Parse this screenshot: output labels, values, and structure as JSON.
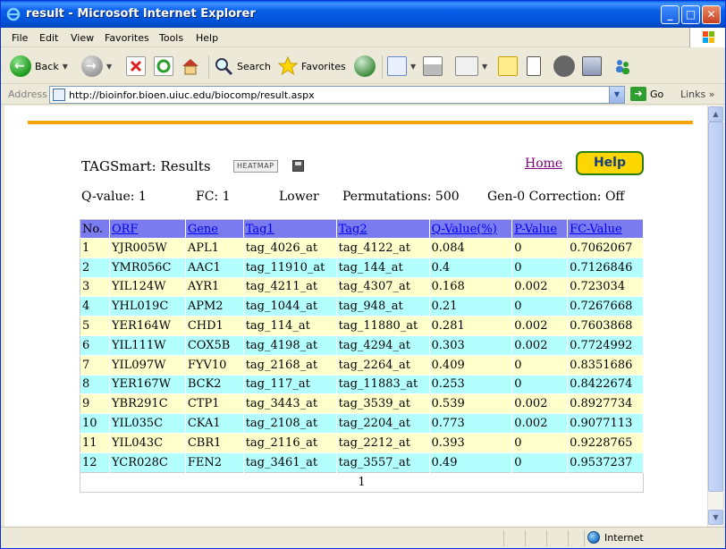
{
  "window": {
    "title": "result - Microsoft Internet Explorer",
    "controls": {
      "minimize": "_",
      "maximize": "□",
      "close": "✕"
    }
  },
  "menu": [
    "File",
    "Edit",
    "View",
    "Favorites",
    "Tools",
    "Help"
  ],
  "toolbar": {
    "back_label": "Back",
    "search_label": "Search",
    "favorites_label": "Favorites",
    "icons": [
      "back-icon",
      "forward-icon",
      "stop-icon",
      "refresh-icon",
      "home-icon",
      "search-icon",
      "favorites-icon",
      "history-icon",
      "mail-icon",
      "print-icon",
      "edit-icon",
      "discuss-icon",
      "messenger-icon",
      "research-icon",
      "media-icon",
      "people-icon"
    ]
  },
  "address": {
    "label": "Address",
    "url": "http://bioinfor.bioen.uiuc.edu/biocomp/result.aspx",
    "go_label": "Go",
    "links_label": "Links"
  },
  "page": {
    "title": "TAGSmart: Results",
    "heatmap_label": "HEATMAP",
    "home_label": "Home",
    "help_label": "Help",
    "accent_color": "#f5a400",
    "params": {
      "qvalue": "Q-value:  1",
      "fc": "FC:  1",
      "direction": "Lower",
      "permutations": "Permutations:  500",
      "gen0": "Gen-0 Correction:  Off"
    }
  },
  "table": {
    "headers": [
      "No.",
      "ORF",
      "Gene",
      "Tag1",
      "Tag2",
      "Q-Value(%)",
      "P-Value",
      "FC-Value"
    ],
    "header_links": [
      false,
      true,
      true,
      true,
      true,
      true,
      true,
      true
    ],
    "rows": [
      [
        "1",
        "YJR005W",
        "APL1",
        "tag_4026_at",
        "tag_4122_at",
        "0.084",
        "0",
        "0.7062067"
      ],
      [
        "2",
        "YMR056C",
        "AAC1",
        "tag_11910_at",
        "tag_144_at",
        "0.4",
        "0",
        "0.7126846"
      ],
      [
        "3",
        "YIL124W",
        "AYR1",
        "tag_4211_at",
        "tag_4307_at",
        "0.168",
        "0.002",
        "0.723034"
      ],
      [
        "4",
        "YHL019C",
        "APM2",
        "tag_1044_at",
        "tag_948_at",
        "0.21",
        "0",
        "0.7267668"
      ],
      [
        "5",
        "YER164W",
        "CHD1",
        "tag_114_at",
        "tag_11880_at",
        "0.281",
        "0.002",
        "0.7603868"
      ],
      [
        "6",
        "YIL111W",
        "COX5B",
        "tag_4198_at",
        "tag_4294_at",
        "0.303",
        "0.002",
        "0.7724992"
      ],
      [
        "7",
        "YIL097W",
        "FYV10",
        "tag_2168_at",
        "tag_2264_at",
        "0.409",
        "0",
        "0.8351686"
      ],
      [
        "8",
        "YER167W",
        "BCK2",
        "tag_117_at",
        "tag_11883_at",
        "0.253",
        "0",
        "0.8422674"
      ],
      [
        "9",
        "YBR291C",
        "CTP1",
        "tag_3443_at",
        "tag_3539_at",
        "0.539",
        "0.002",
        "0.8927734"
      ],
      [
        "10",
        "YIL035C",
        "CKA1",
        "tag_2108_at",
        "tag_2204_at",
        "0.773",
        "0.002",
        "0.9077113"
      ],
      [
        "11",
        "YIL043C",
        "CBR1",
        "tag_2116_at",
        "tag_2212_at",
        "0.393",
        "0",
        "0.9228765"
      ],
      [
        "12",
        "YCR028C",
        "FEN2",
        "tag_3461_at",
        "tag_3557_at",
        "0.49",
        "0",
        "0.9537237"
      ]
    ],
    "pager": "1"
  },
  "status": {
    "zone": "Internet"
  }
}
